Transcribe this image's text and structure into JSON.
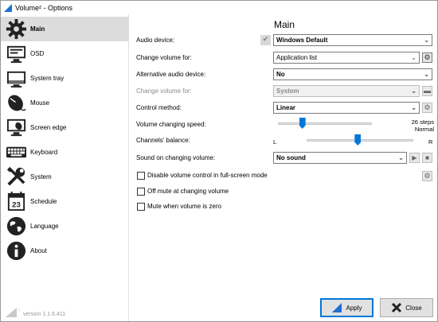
{
  "window": {
    "title": "Volume² - Options"
  },
  "sidebar": {
    "items": [
      {
        "label": "Main",
        "icon": "gear-icon"
      },
      {
        "label": "OSD",
        "icon": "monitor-icon"
      },
      {
        "label": "System tray",
        "icon": "tray-icon"
      },
      {
        "label": "Mouse",
        "icon": "mouse-icon"
      },
      {
        "label": "Screen edge",
        "icon": "screen-edge-icon"
      },
      {
        "label": "Keyboard",
        "icon": "keyboard-icon"
      },
      {
        "label": "System",
        "icon": "tools-icon"
      },
      {
        "label": "Schedule",
        "icon": "calendar-icon"
      },
      {
        "label": "Language",
        "icon": "globe-icon"
      },
      {
        "label": "About",
        "icon": "info-icon"
      }
    ],
    "selected": "Main",
    "calendar_day": "23",
    "version": "version 1.1.6.411"
  },
  "main": {
    "title": "Main",
    "audio_device": {
      "label": "Audio device:",
      "value": "Windows Default"
    },
    "change_volume_for": {
      "label": "Change volume for:",
      "value": "Application list"
    },
    "alt_audio_device": {
      "label": "Alternative audio device:",
      "value": "No"
    },
    "change_volume_for_alt": {
      "label": "Change volume for:",
      "value": "System"
    },
    "control_method": {
      "label": "Control method:",
      "value": "Linear"
    },
    "volume_speed": {
      "label": "Volume changing speed:",
      "value_text": "26 steps",
      "sub_text": "Normal",
      "position": 0.26
    },
    "balance": {
      "label": "Channels' balance:",
      "left": "L",
      "right": "R",
      "position": 0.48
    },
    "sound_on_change": {
      "label": "Sound on changing volume:",
      "value": "No sound"
    },
    "checkboxes": [
      {
        "label": "Disable volume control in full-screen mode",
        "checked": false
      },
      {
        "label": "Off mute at changing volume",
        "checked": false
      },
      {
        "label": "Mute when volume is zero",
        "checked": false
      }
    ]
  },
  "footer": {
    "apply_label": "Apply",
    "close_label": "Close"
  },
  "colors": {
    "accent": "#0078d7",
    "selected_bg": "#dcdcdc"
  }
}
